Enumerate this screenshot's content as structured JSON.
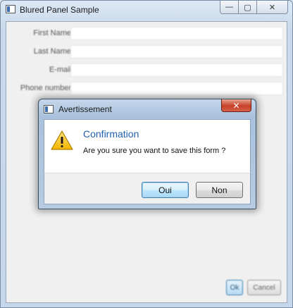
{
  "window": {
    "title": "Blured Panel Sample",
    "caption": {
      "minimize": "—",
      "maximize": "▢",
      "close": "✕"
    }
  },
  "form": {
    "fields": [
      {
        "label": "First Name",
        "value": ""
      },
      {
        "label": "Last Name",
        "value": ""
      },
      {
        "label": "E-mail",
        "value": ""
      },
      {
        "label": "Phone number",
        "value": ""
      }
    ],
    "ok_label": "Ok",
    "cancel_label": "Cancel"
  },
  "dialog": {
    "title": "Avertissement",
    "close_glyph": "✕",
    "heading": "Confirmation",
    "message": "Are you sure you want to save this form ?",
    "yes_label": "Oui",
    "no_label": "Non",
    "icon": "warning-icon",
    "close_color": "#c7402a",
    "heading_color": "#1f5fae"
  }
}
